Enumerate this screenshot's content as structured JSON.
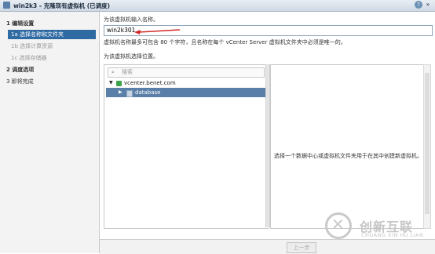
{
  "window": {
    "title": "win2k3 - 克隆现有虚拟机 (已调度)"
  },
  "steps": [
    {
      "label": "1  编辑设置"
    },
    {
      "label": "1a  选择名称和文件夹"
    },
    {
      "label": "1b  选择计算资源"
    },
    {
      "label": "1c  选择存储器"
    },
    {
      "label": "2  调度选项"
    },
    {
      "label": "3  即将完成"
    }
  ],
  "name_section": {
    "label": "为该虚拟机输入名称。",
    "value": "win2k301",
    "hint": "虚拟机名称最多可包含 80 个字符，且名称在每个 vCenter Server 虚拟机文件夹中必须是唯一的。"
  },
  "location_section": {
    "label": "为该虚拟机选择位置。",
    "search_placeholder": "搜索",
    "tree": [
      {
        "label": "vcenter.benet.com",
        "icon": "datacenter-icon"
      },
      {
        "label": "database",
        "icon": "folder-icon",
        "selected": true
      }
    ],
    "info_message": "选择一个数据中心或虚拟机文件夹用于在其中创建新虚拟机。"
  },
  "footer": {
    "prev_label": "上一步"
  },
  "watermark": {
    "text": "创新互联",
    "sub": "CHUANG XIN HU LIAN"
  },
  "colors": {
    "accent": "#2f6aa3",
    "selection": "#5a7fa8",
    "arrow": "#d12a2a"
  }
}
